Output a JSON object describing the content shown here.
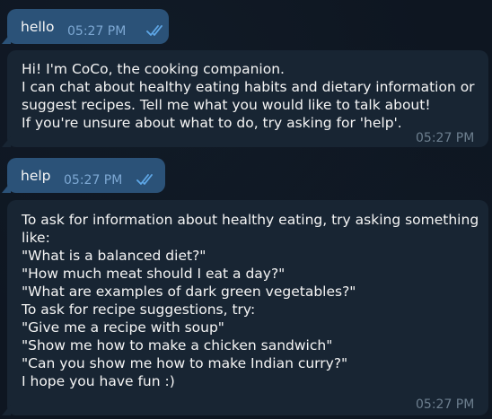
{
  "messages": [
    {
      "direction": "outgoing",
      "lines": [
        "hello"
      ],
      "time": "05:27 PM",
      "status_icon": "double-check-read-icon"
    },
    {
      "direction": "incoming",
      "lines": [
        "Hi! I'm CoCo, the cooking companion.",
        "I can chat about healthy eating habits and dietary information or",
        "suggest recipes. Tell me what you would like to talk about!",
        "If you're unsure about what to do, try asking for 'help'."
      ],
      "time": "05:27 PM"
    },
    {
      "direction": "outgoing",
      "lines": [
        "help"
      ],
      "time": "05:27 PM",
      "status_icon": "double-check-read-icon"
    },
    {
      "direction": "incoming",
      "lines": [
        "To ask for information about healthy eating, try asking something",
        "like:",
        "\"What is a balanced diet?\"",
        "\"How much meat should I eat a day?\"",
        "\"What are examples of dark green vegetables?\"",
        "To ask for recipe suggestions, try:",
        "\"Give me a recipe with soup\"",
        "\"Show me how to make a chicken sandwich\"",
        "\"Can you show me how to make Indian curry?\"",
        "I hope you have fun :)"
      ],
      "time": "05:27 PM"
    }
  ],
  "colors": {
    "background": "#0e1621",
    "outgoing_bubble": "#2b5278",
    "incoming_bubble": "#182533",
    "read_check": "#5fa8e8",
    "time_incoming": "#6d7f8f"
  }
}
